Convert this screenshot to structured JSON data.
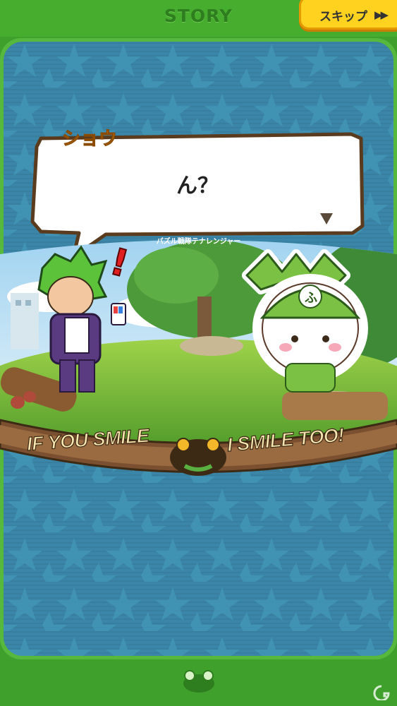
{
  "header": {
    "title": "STORY",
    "skip_label": "スキップ",
    "skip_icon": "fast-forward-icon"
  },
  "dialog": {
    "speaker": "ショウ",
    "text": "ん？",
    "next_icon": "triangle-down-icon"
  },
  "scene": {
    "subtitle": "パズル戦隊テナレンジャー",
    "slogan_left": "IF YOU SMILE",
    "slogan_right": "I SMILE TOO!"
  },
  "footer": {
    "icon": "puzzle-creature-icon",
    "watermark_icon": "site-logo-icon"
  },
  "colors": {
    "frame_green": "#46ad2f",
    "panel_blue": "#3b86a8",
    "skip_yellow": "#ffd21f",
    "speaker_orange": "#f3a712"
  }
}
